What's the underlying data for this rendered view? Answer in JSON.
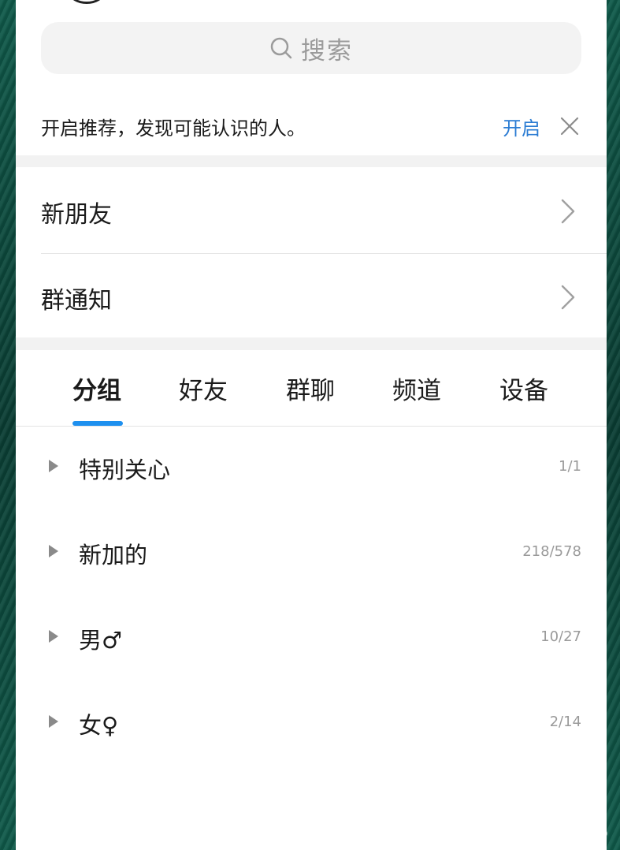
{
  "search": {
    "label": "搜索",
    "icon": "search-icon"
  },
  "recommend": {
    "text": "开启推荐，发现可能认识的人。",
    "action": "开启",
    "close_icon": "close-icon"
  },
  "entries": [
    {
      "label": "新朋友"
    },
    {
      "label": "群通知"
    }
  ],
  "tabs": [
    {
      "label": "分组",
      "active": true
    },
    {
      "label": "好友"
    },
    {
      "label": "群聊"
    },
    {
      "label": "频道"
    },
    {
      "label": "设备"
    }
  ],
  "groups": [
    {
      "name": "特别关心",
      "count": "1/1"
    },
    {
      "name": "新加的",
      "count": "218/578"
    },
    {
      "name": "男♂",
      "count": "10/27"
    },
    {
      "name": "女♀",
      "count": "2/14"
    }
  ],
  "colors": {
    "accent": "#1e90ef",
    "link": "#2b7cd3"
  }
}
